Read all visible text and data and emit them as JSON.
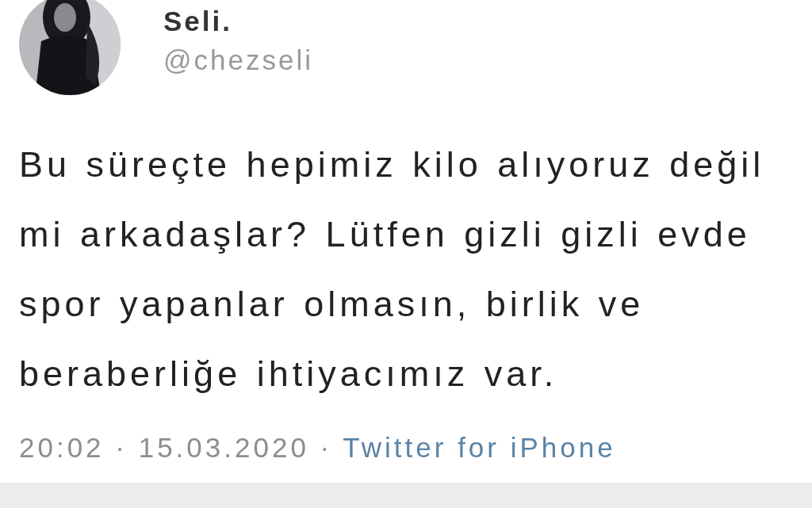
{
  "tweet": {
    "author": {
      "name": "Seli.",
      "handle": "@chezseli"
    },
    "text": "Bu süreçte hepimiz kilo alıyoruz değil mi arkadaşlar? Lütfen gizli gizli evde spor yapanlar olmasın, birlik ve beraberliğe ihtiyacımız var.",
    "timestamp": "20:02 · 15.03.2020 ·",
    "source": "Twitter for iPhone"
  }
}
